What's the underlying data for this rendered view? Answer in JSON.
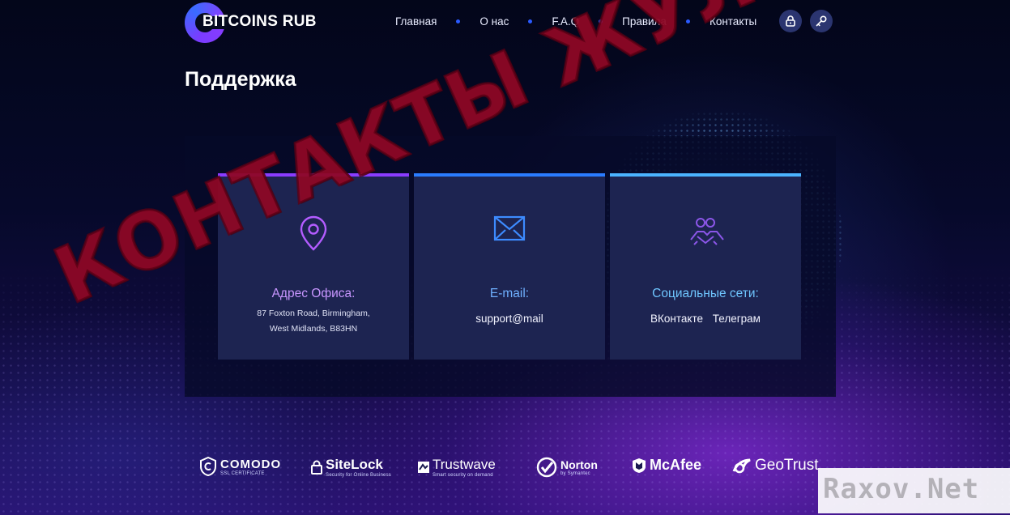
{
  "header": {
    "logo_text": "BITCOINS RUB",
    "nav": [
      "Главная",
      "О нас",
      "F.A.Q",
      "Правила",
      "Контакты"
    ],
    "icons": [
      "lock-icon",
      "key-icon"
    ]
  },
  "page": {
    "title": "Поддержка"
  },
  "cards": [
    {
      "title": "Адрес Офиса:",
      "body_lines": [
        "87 Foxton Road, Birmingham,",
        "West Midlands, B83HN"
      ],
      "icon": "map-pin-icon",
      "accent": "#8a3cff"
    },
    {
      "title": "E-mail:",
      "body": "support@mail",
      "icon": "envelope-icon",
      "accent": "#2a7cff"
    },
    {
      "title": "Социальные сети:",
      "links": [
        "ВКонтакте",
        "Телеграм"
      ],
      "icon": "handshake-icon",
      "accent": "#4bb4ff"
    }
  ],
  "partners": [
    {
      "name": "COMODO",
      "sub": "SSL CERTIFICATE"
    },
    {
      "name": "SiteLock",
      "sub": "Security for Online Business"
    },
    {
      "name": "Trustwave",
      "sub": "Smart security on demand"
    },
    {
      "name": "Norton",
      "sub": "by Symantec"
    },
    {
      "name": "McAfee",
      "sub": ""
    },
    {
      "name": "GeoTrust",
      "sub": ""
    }
  ],
  "overlay": {
    "stamp_text": "КОНТАКТЫ ЖУЛИКОВ",
    "watermark": "Raxov.Net"
  },
  "colors": {
    "background": "#050a1f",
    "nav_dot": "#2a5aff",
    "card": "#1d2451",
    "card_title_1": "#c896ff",
    "card_title_2": "#6fb0ff",
    "card_title_3": "#6fc6ff",
    "stamp": "#96082a"
  }
}
